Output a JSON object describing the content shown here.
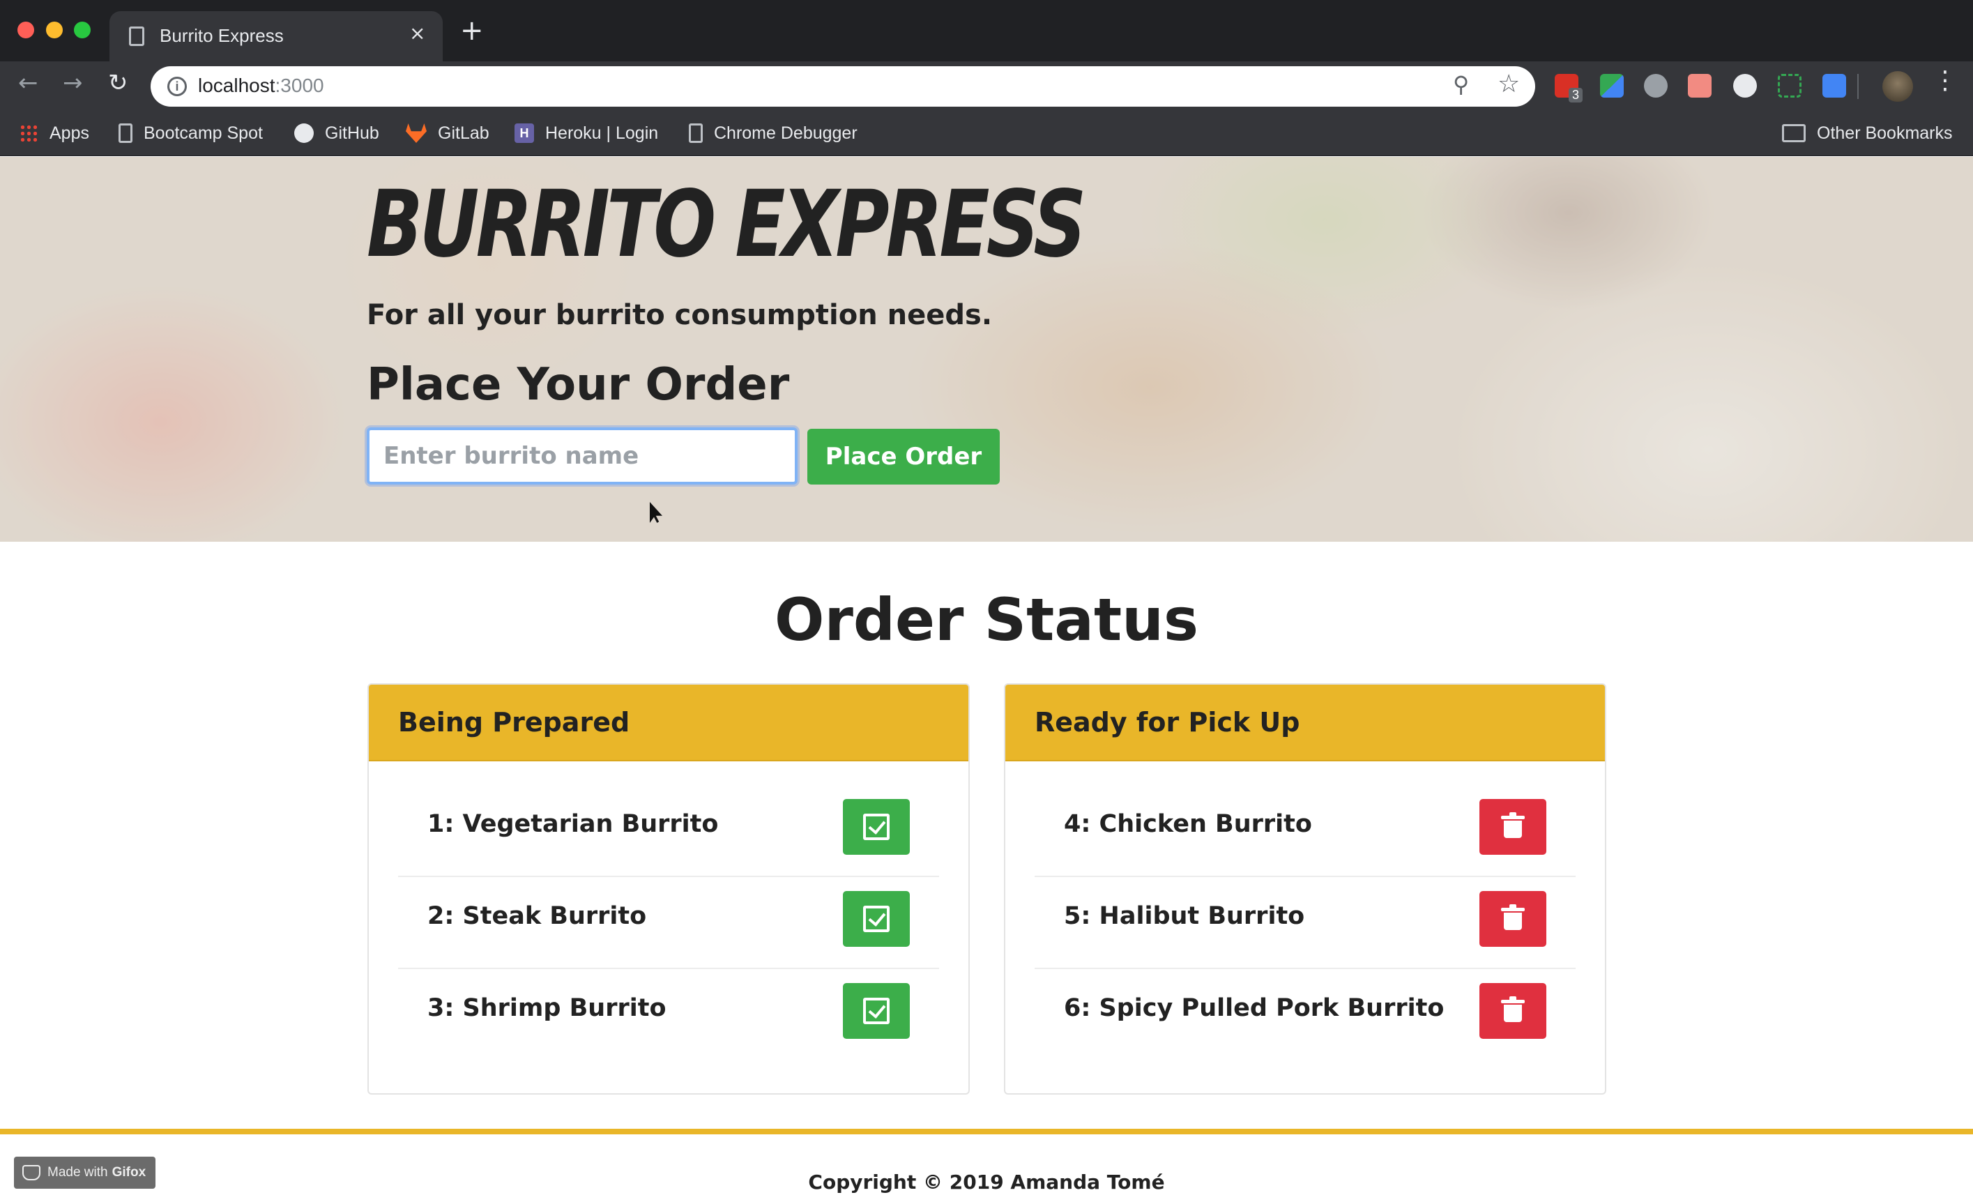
{
  "browser": {
    "tab_title": "Burrito Express",
    "tab_close": "×",
    "new_tab": "+",
    "url_host": "localhost",
    "url_port": ":3000",
    "extension_badge": "3",
    "bookmarks": [
      {
        "label": "Apps",
        "icon": "apps-grid-icon"
      },
      {
        "label": "Bootcamp Spot",
        "icon": "page-icon"
      },
      {
        "label": "GitHub",
        "icon": "github-icon"
      },
      {
        "label": "GitLab",
        "icon": "gitlab-icon"
      },
      {
        "label": "Heroku | Login",
        "icon": "heroku-icon"
      },
      {
        "label": "Chrome Debugger",
        "icon": "page-icon"
      }
    ],
    "other_bookmarks": "Other Bookmarks"
  },
  "hero": {
    "site_title": "BURRITO EXPRESS",
    "tagline": "For all your burrito consumption needs.",
    "order_heading": "Place Your Order",
    "input_placeholder": "Enter burrito name",
    "input_value": "",
    "place_button": "Place Order"
  },
  "status": {
    "title": "Order Status",
    "preparing": {
      "header": "Being Prepared",
      "items": [
        {
          "label": "1: Vegetarian Burrito"
        },
        {
          "label": "2: Steak Burrito"
        },
        {
          "label": "3: Shrimp Burrito"
        }
      ],
      "action_icon": "checkbox-icon"
    },
    "ready": {
      "header": "Ready for Pick Up",
      "items": [
        {
          "label": "4: Chicken Burrito"
        },
        {
          "label": "5: Halibut Burrito"
        },
        {
          "label": "6: Spicy Pulled Pork Burrito"
        }
      ],
      "action_icon": "trash-icon"
    }
  },
  "footer": {
    "copyright": "Copyright © 2019 Amanda Tomé",
    "gifox_prefix": "Made with",
    "gifox_brand": "Gifox"
  },
  "colors": {
    "accent_yellow": "#e9b629",
    "button_green": "#3cae4a",
    "button_red": "#e0303f"
  }
}
